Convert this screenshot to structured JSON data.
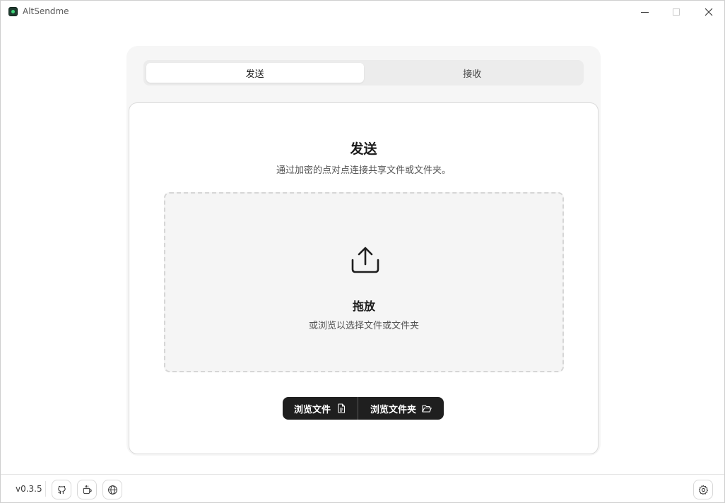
{
  "window": {
    "title": "AltSendme",
    "icons": {
      "app": "app-icon",
      "minimize": "minimize-icon",
      "maximize": "maximize-icon",
      "close": "close-icon"
    }
  },
  "tabs": [
    {
      "label": "发送",
      "active": true
    },
    {
      "label": "接收",
      "active": false
    }
  ],
  "send": {
    "heading": "发送",
    "description": "通过加密的点对点连接共享文件或文件夹。",
    "dropzone": {
      "icon": "upload-icon",
      "title": "拖放",
      "subtitle": "或浏览以选择文件或文件夹"
    },
    "buttons": {
      "browse_files": "浏览文件",
      "browse_files_icon": "file-icon",
      "browse_folder": "浏览文件夹",
      "browse_folder_icon": "folder-open-icon"
    }
  },
  "footer": {
    "version": "v0.3.5",
    "icons": [
      "github-icon",
      "coffee-icon",
      "globe-icon",
      "gear-icon"
    ]
  },
  "colors": {
    "button_bg": "#1f1f1f",
    "panel_bg": "#f6f6f6",
    "dropzone_bg": "#f5f5f5"
  }
}
